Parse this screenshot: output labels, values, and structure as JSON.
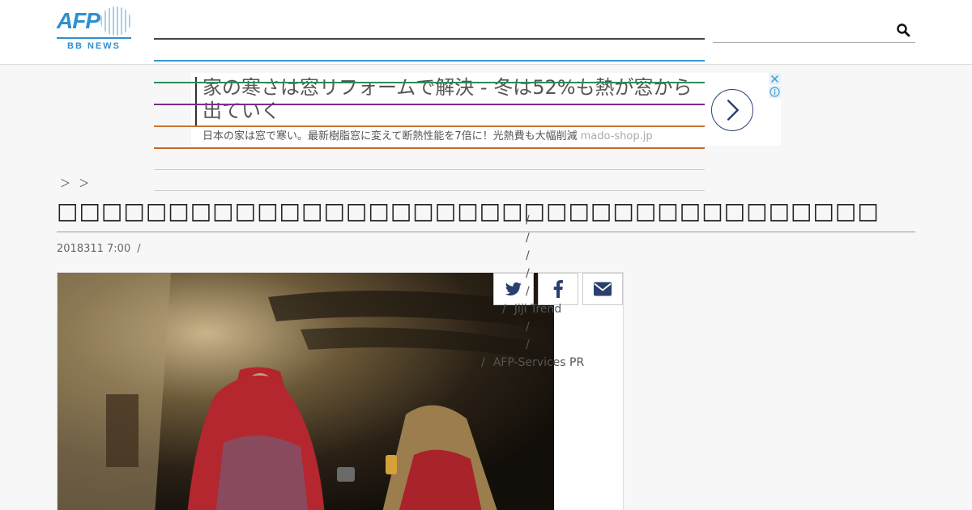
{
  "header": {
    "logo_text": "AFP",
    "logo_subtext": "BB NEWS",
    "search": {
      "placeholder": "",
      "icon": "search-icon"
    }
  },
  "nav": {
    "line_colors": [
      "#444444",
      "#3399cc",
      "#2e8b57",
      "#7b2d8e",
      "#c87533",
      "#c8652a",
      "#cccccc",
      "#cccccc"
    ]
  },
  "ad": {
    "title": "家の寒さは窓リフォームで解決 - 冬は52%も熱が窓から出ていく",
    "description": "日本の家は窓で寒い。最新樹脂窓に変えて断熱性能を7倍に！光熱費も大幅削減",
    "domain": "mado-shop.jp",
    "close_icon": "close-icon",
    "info_icon": "info-icon",
    "arrow_icon": "chevron-right-icon"
  },
  "breadcrumb": "＞ ＞",
  "article": {
    "title": "□□□□□□□□□□□□□□□□□□□□□□□□□□□□□□□□□□□□□",
    "date": "2018311 7:00",
    "date_separator": "/"
  },
  "related_tags": [
    {
      "slash": "/",
      "label": ""
    },
    {
      "slash": "/",
      "label": ""
    },
    {
      "slash": "/",
      "label": ""
    },
    {
      "slash": "/",
      "label": ""
    },
    {
      "slash": "/",
      "label": ""
    },
    {
      "slash": "/",
      "label": "Jiji Trend"
    },
    {
      "slash": "/",
      "label": ""
    },
    {
      "slash": "/",
      "label": ""
    },
    {
      "slash": "/",
      "label": "AFP-Services PR"
    }
  ],
  "share": {
    "twitter_icon": "twitter-icon",
    "facebook_icon": "facebook-icon",
    "email_icon": "envelope-icon"
  },
  "colors": {
    "brand": "#2f8fd0",
    "share_icon": "#2a3f6e"
  }
}
